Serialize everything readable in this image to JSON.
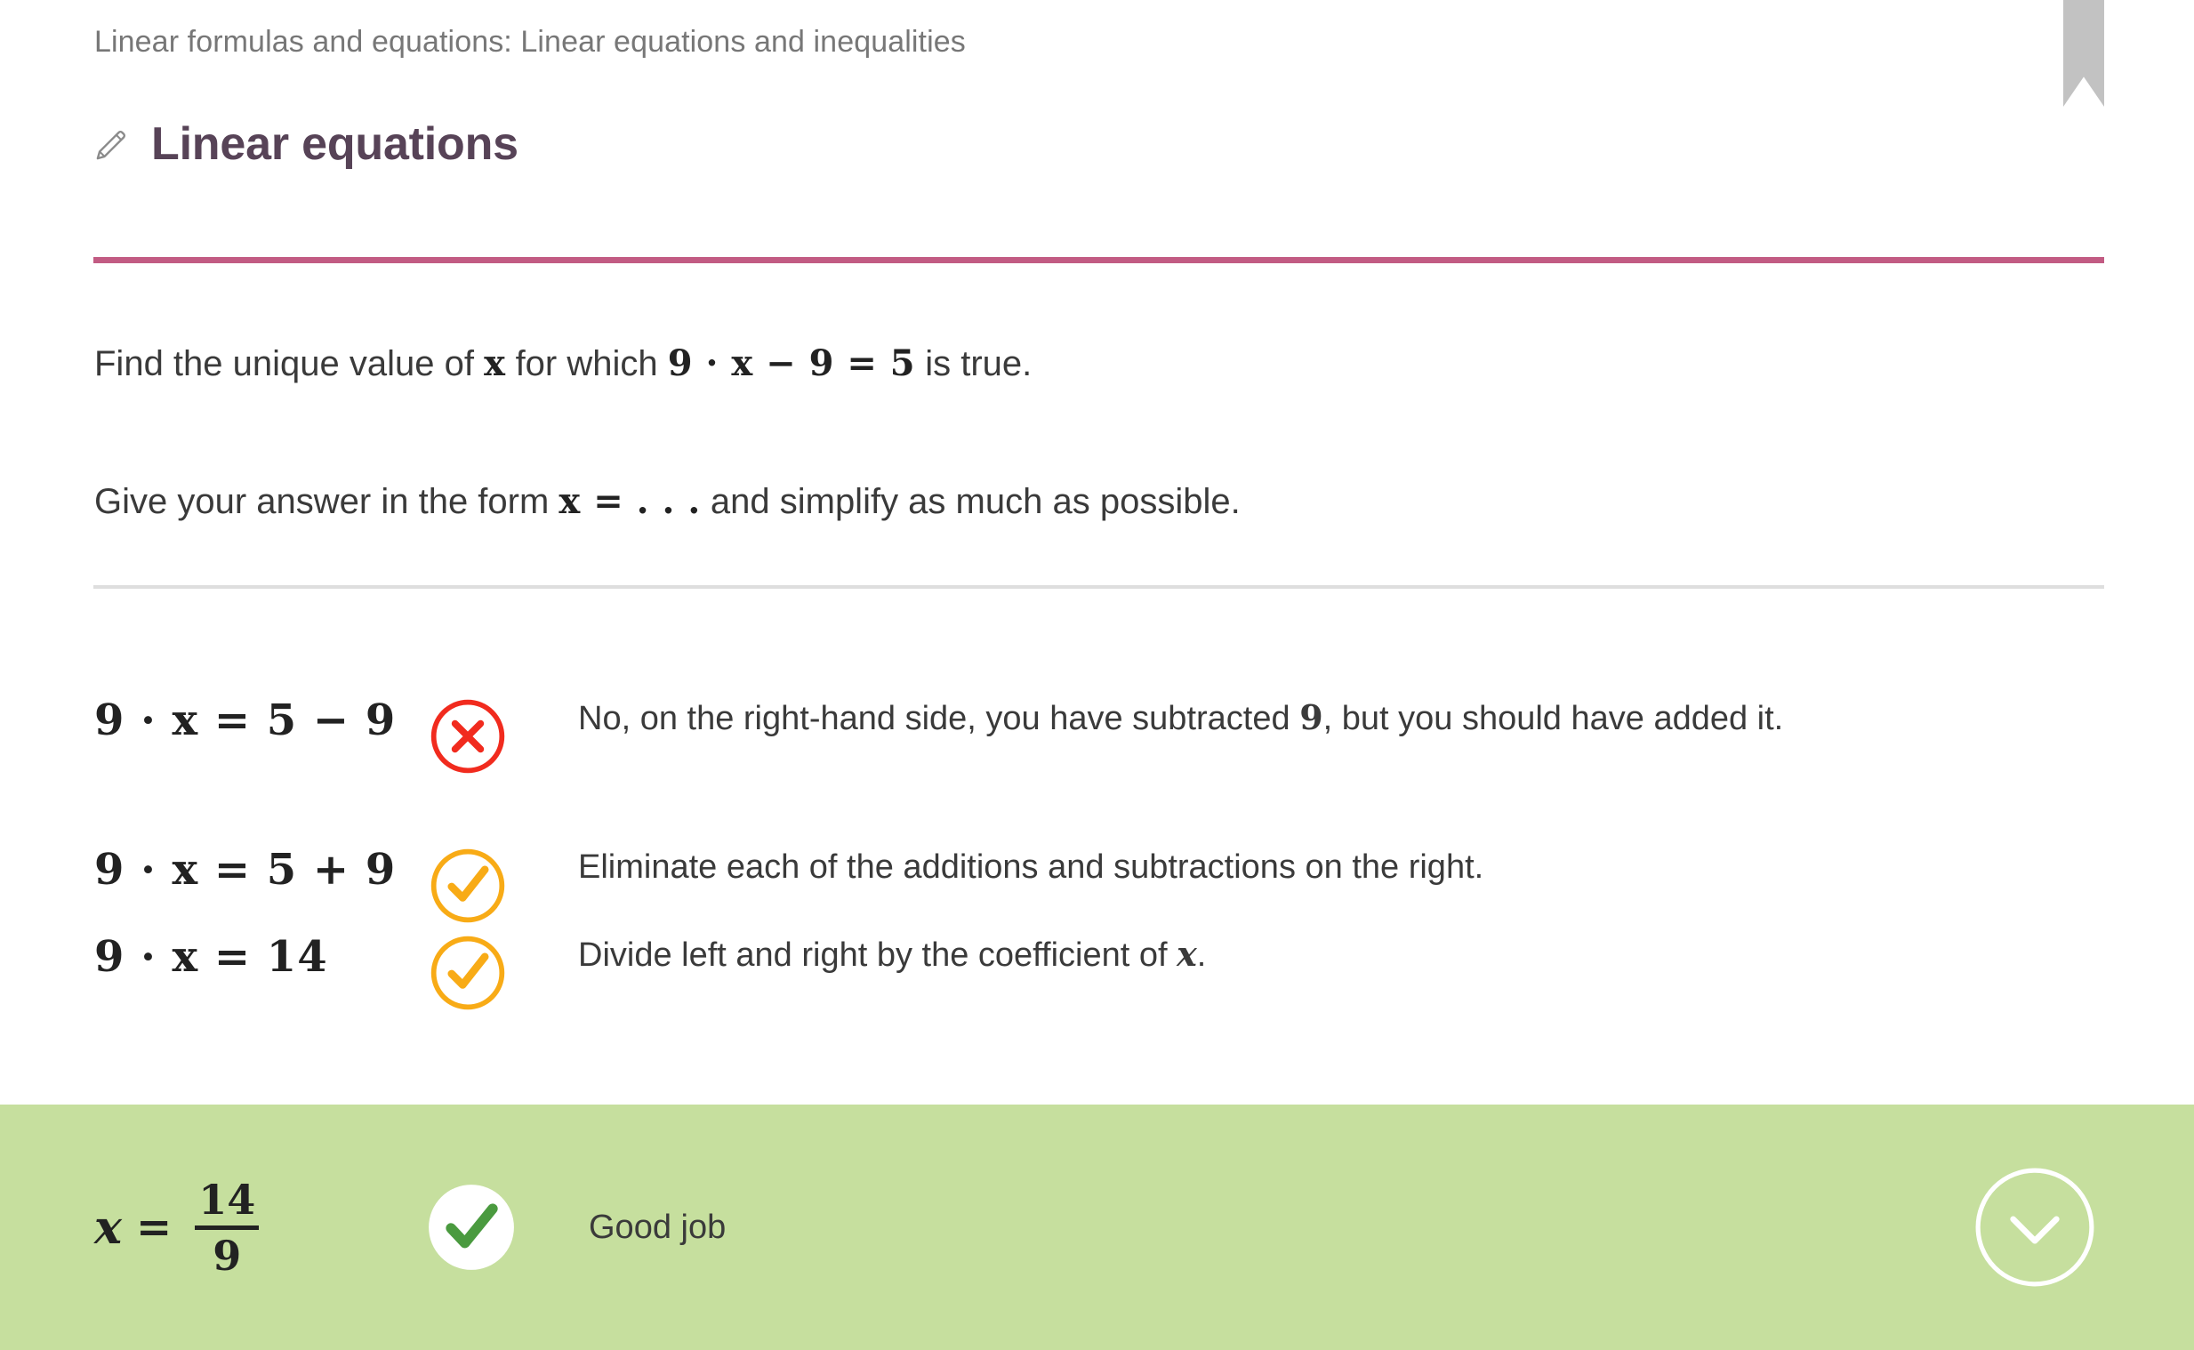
{
  "breadcrumb": "Linear formulas and equations: Linear equations and inequalities",
  "title": "Linear equations",
  "icons": {
    "pencil": "pencil-icon",
    "bookmark": "bookmark-icon",
    "cross": "cross-circle-icon",
    "check_amber": "check-circle-icon",
    "check_green": "check-circle-filled-icon",
    "chevron": "chevron-down-icon"
  },
  "colors": {
    "title": "#574357",
    "rule_pink": "#c25b83",
    "rule_grey": "#dedede",
    "banner_green": "#c6df9e",
    "check_green": "#4a9a3f",
    "check_amber": "#f8ab16",
    "cross_red": "#f12b1e",
    "bookmark_grey": "#c2c2c2",
    "breadcrumb_grey": "#777777",
    "body_text": "#3a3a3a"
  },
  "problem": {
    "line1_pre": "Find the unique value of ",
    "line1_var": "x",
    "line1_mid": " for which ",
    "line1_eq": "9 · x − 9 = 5",
    "line1_post": " is true.",
    "line2_pre": "Give your answer in the form ",
    "line2_eq": "x = . . .",
    "line2_post": " and simplify as much as possible."
  },
  "steps": [
    {
      "equation": "9 · x = 5 − 9",
      "status": "incorrect",
      "icon": "cross-circle-icon",
      "feedback_pre": "No, on the right-hand side, you have subtracted ",
      "feedback_num": "9",
      "feedback_post": ", but you should have added it.",
      "feedback_plain": "No, on the right-hand side, you have subtracted 9, but you should have added it."
    },
    {
      "equation": "9 · x = 5 + 9",
      "status": "correct",
      "icon": "check-circle-icon",
      "feedback_plain": "Eliminate each of the additions and subtractions on the right."
    },
    {
      "equation": "9 · x = 14",
      "status": "correct",
      "icon": "check-circle-icon",
      "feedback_pre": "Divide left and right by the coefficient of ",
      "feedback_var": "x",
      "feedback_post": ".",
      "feedback_plain": "Divide left and right by the coefficient of x."
    }
  ],
  "answer": {
    "variable": "x",
    "equals": "=",
    "numerator": "14",
    "denominator": "9",
    "equation_plain": "x = 14/9",
    "status": "correct",
    "message": "Good job",
    "next_label": "chevron-down-icon"
  }
}
